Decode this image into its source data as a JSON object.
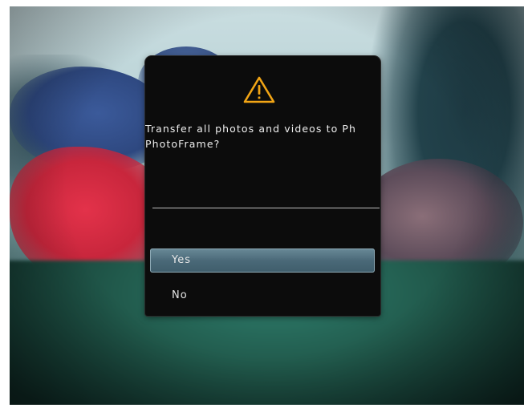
{
  "dialog": {
    "icon": "warning-triangle-icon",
    "message_lines": [
      "Transfer all photos and videos to Ph",
      "PhotoFrame?"
    ],
    "options": [
      {
        "label": "Yes",
        "selected": true
      },
      {
        "label": "No",
        "selected": false
      }
    ]
  },
  "colors": {
    "dialog_background": "#0c0c0c",
    "warning_icon": "#f2a515",
    "selection_highlight": "#4a6978",
    "text": "#eeeeee"
  }
}
